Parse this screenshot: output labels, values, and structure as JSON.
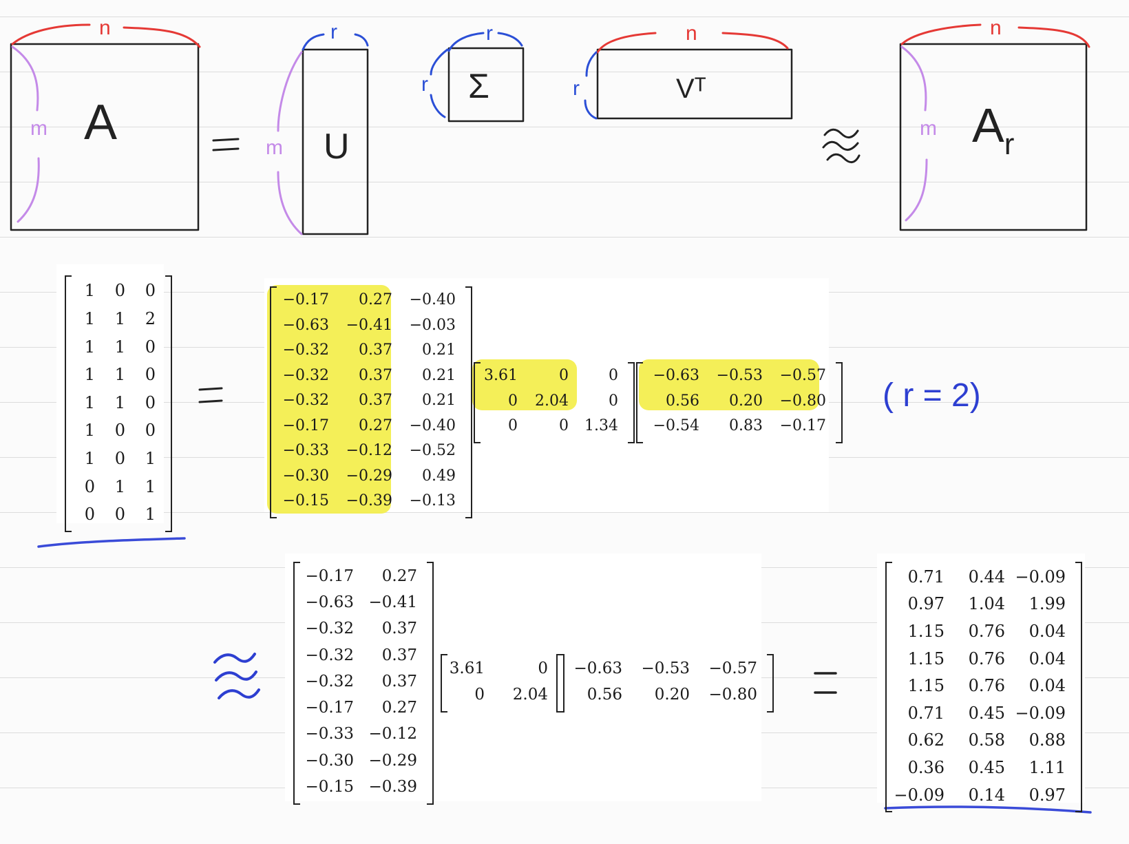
{
  "schematic": {
    "a": {
      "label": "A",
      "rows_label": "m",
      "cols_label": "n"
    },
    "u": {
      "label": "U",
      "rows_label": "m",
      "cols_label": "r"
    },
    "sigma": {
      "label": "Σ",
      "rows_label": "r",
      "cols_label": "r"
    },
    "vt": {
      "label": "Vᵀ",
      "rows_label": "r",
      "cols_label": "n"
    },
    "ar": {
      "label": "A",
      "label_sub": "r",
      "rows_label": "m",
      "cols_label": "n"
    },
    "equals_symbol": "=",
    "approx_symbol": "≈"
  },
  "row2": {
    "matrix_a": [
      [
        "1",
        "0",
        "0"
      ],
      [
        "1",
        "1",
        "2"
      ],
      [
        "1",
        "1",
        "0"
      ],
      [
        "1",
        "1",
        "0"
      ],
      [
        "1",
        "1",
        "0"
      ],
      [
        "1",
        "0",
        "0"
      ],
      [
        "1",
        "0",
        "1"
      ],
      [
        "0",
        "1",
        "1"
      ],
      [
        "0",
        "0",
        "1"
      ]
    ],
    "equals_symbol": "=",
    "matrix_u": [
      [
        "−0.17",
        "0.27",
        "−0.40"
      ],
      [
        "−0.63",
        "−0.41",
        "−0.03"
      ],
      [
        "−0.32",
        "0.37",
        "0.21"
      ],
      [
        "−0.32",
        "0.37",
        "0.21"
      ],
      [
        "−0.32",
        "0.37",
        "0.21"
      ],
      [
        "−0.17",
        "0.27",
        "−0.40"
      ],
      [
        "−0.33",
        "−0.12",
        "−0.52"
      ],
      [
        "−0.30",
        "−0.29",
        "0.49"
      ],
      [
        "−0.15",
        "−0.39",
        "−0.13"
      ]
    ],
    "matrix_sigma": [
      [
        "3.61",
        "0",
        "0"
      ],
      [
        "0",
        "2.04",
        "0"
      ],
      [
        "0",
        "0",
        "1.34"
      ]
    ],
    "matrix_vt": [
      [
        "−0.63",
        "−0.53",
        "−0.57"
      ],
      [
        "0.56",
        "0.20",
        "−0.80"
      ],
      [
        "−0.54",
        "0.83",
        "−0.17"
      ]
    ],
    "rank_note": "( r = 2)"
  },
  "row3": {
    "approx_symbol": "≈",
    "matrix_u2": [
      [
        "−0.17",
        "0.27"
      ],
      [
        "−0.63",
        "−0.41"
      ],
      [
        "−0.32",
        "0.37"
      ],
      [
        "−0.32",
        "0.37"
      ],
      [
        "−0.32",
        "0.37"
      ],
      [
        "−0.17",
        "0.27"
      ],
      [
        "−0.33",
        "−0.12"
      ],
      [
        "−0.30",
        "−0.29"
      ],
      [
        "−0.15",
        "−0.39"
      ]
    ],
    "matrix_sigma2": [
      [
        "3.61",
        "0"
      ],
      [
        "0",
        "2.04"
      ]
    ],
    "matrix_vt2": [
      [
        "−0.63",
        "−0.53",
        "−0.57"
      ],
      [
        "0.56",
        "0.20",
        "−0.80"
      ]
    ],
    "equals_symbol": "=",
    "matrix_ar": [
      [
        "0.71",
        "0.44",
        "−0.09"
      ],
      [
        "0.97",
        "1.04",
        "1.99"
      ],
      [
        "1.15",
        "0.76",
        "0.04"
      ],
      [
        "1.15",
        "0.76",
        "0.04"
      ],
      [
        "1.15",
        "0.76",
        "0.04"
      ],
      [
        "0.71",
        "0.45",
        "−0.09"
      ],
      [
        "0.62",
        "0.58",
        "0.88"
      ],
      [
        "0.36",
        "0.45",
        "1.11"
      ],
      [
        "−0.09",
        "0.14",
        "0.97"
      ]
    ]
  },
  "colors": {
    "n_brace": "#e53935",
    "m_brace": "#c48ae8",
    "r_brace": "#2b4fd6",
    "ink": "#222222",
    "blue_ink": "#2d3fd1",
    "highlight": "#f3ee4a"
  }
}
